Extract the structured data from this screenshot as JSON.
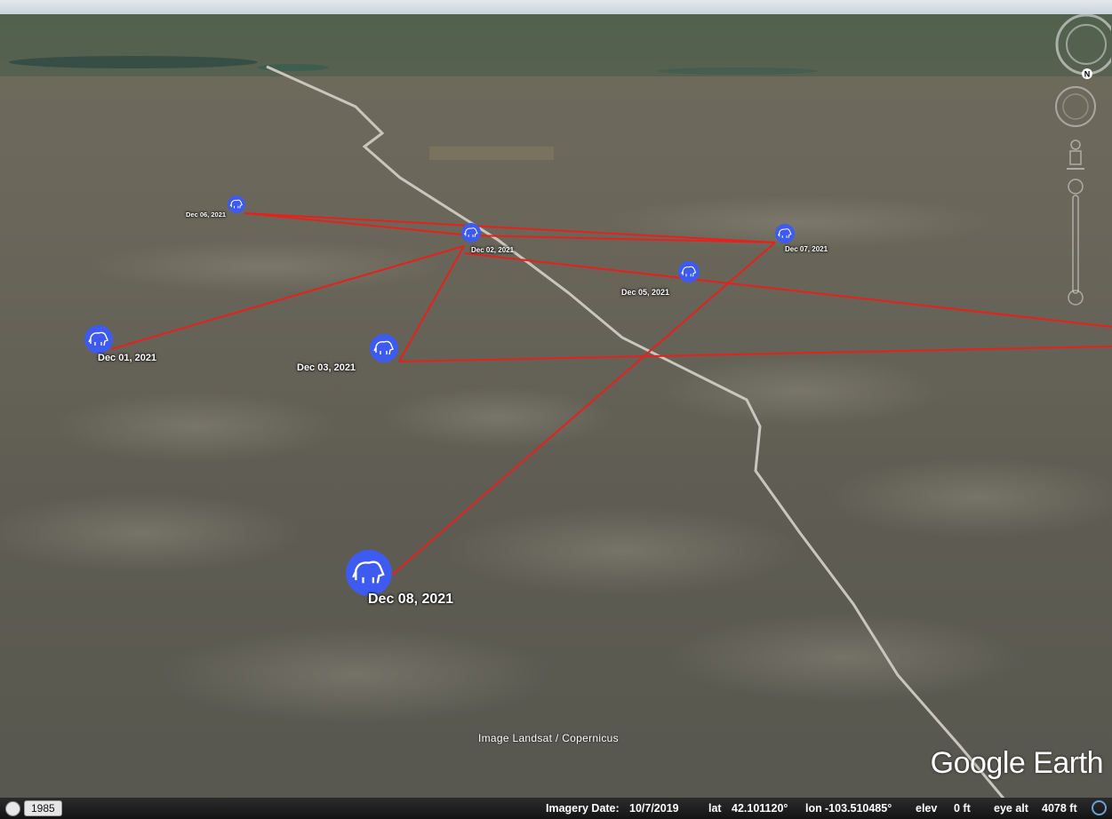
{
  "map": {
    "placemarks": [
      {
        "label": "Dec 01, 2021",
        "icon": "bison-icon"
      },
      {
        "label": "Dec 02, 2021",
        "icon": "bison-icon"
      },
      {
        "label": "Dec 03, 2021",
        "icon": "bison-icon"
      },
      {
        "label": "Dec 05, 2021",
        "icon": "bison-icon"
      },
      {
        "label": "Dec 06, 2021",
        "icon": "bison-icon"
      },
      {
        "label": "Dec 07, 2021",
        "icon": "bison-icon"
      },
      {
        "label": "Dec 08, 2021",
        "icon": "bison-icon"
      }
    ],
    "track_color": "#e8201c",
    "placemark_color": "#3d5bf0",
    "attribution": "Image Landsat / Copernicus",
    "brand": "Google Earth"
  },
  "statusbar": {
    "historical_year": "1985",
    "imagery_date_label": "Imagery Date:",
    "imagery_date": "10/7/2019",
    "lat_label": "lat",
    "lat": "42.101120°",
    "lon_label": "lon",
    "lon": "-103.510485°",
    "elev_label": "elev",
    "elev": "0 ft",
    "eye_alt_label": "eye alt",
    "eye_alt": "4078 ft"
  },
  "navigation": {
    "compass_north": "N"
  }
}
